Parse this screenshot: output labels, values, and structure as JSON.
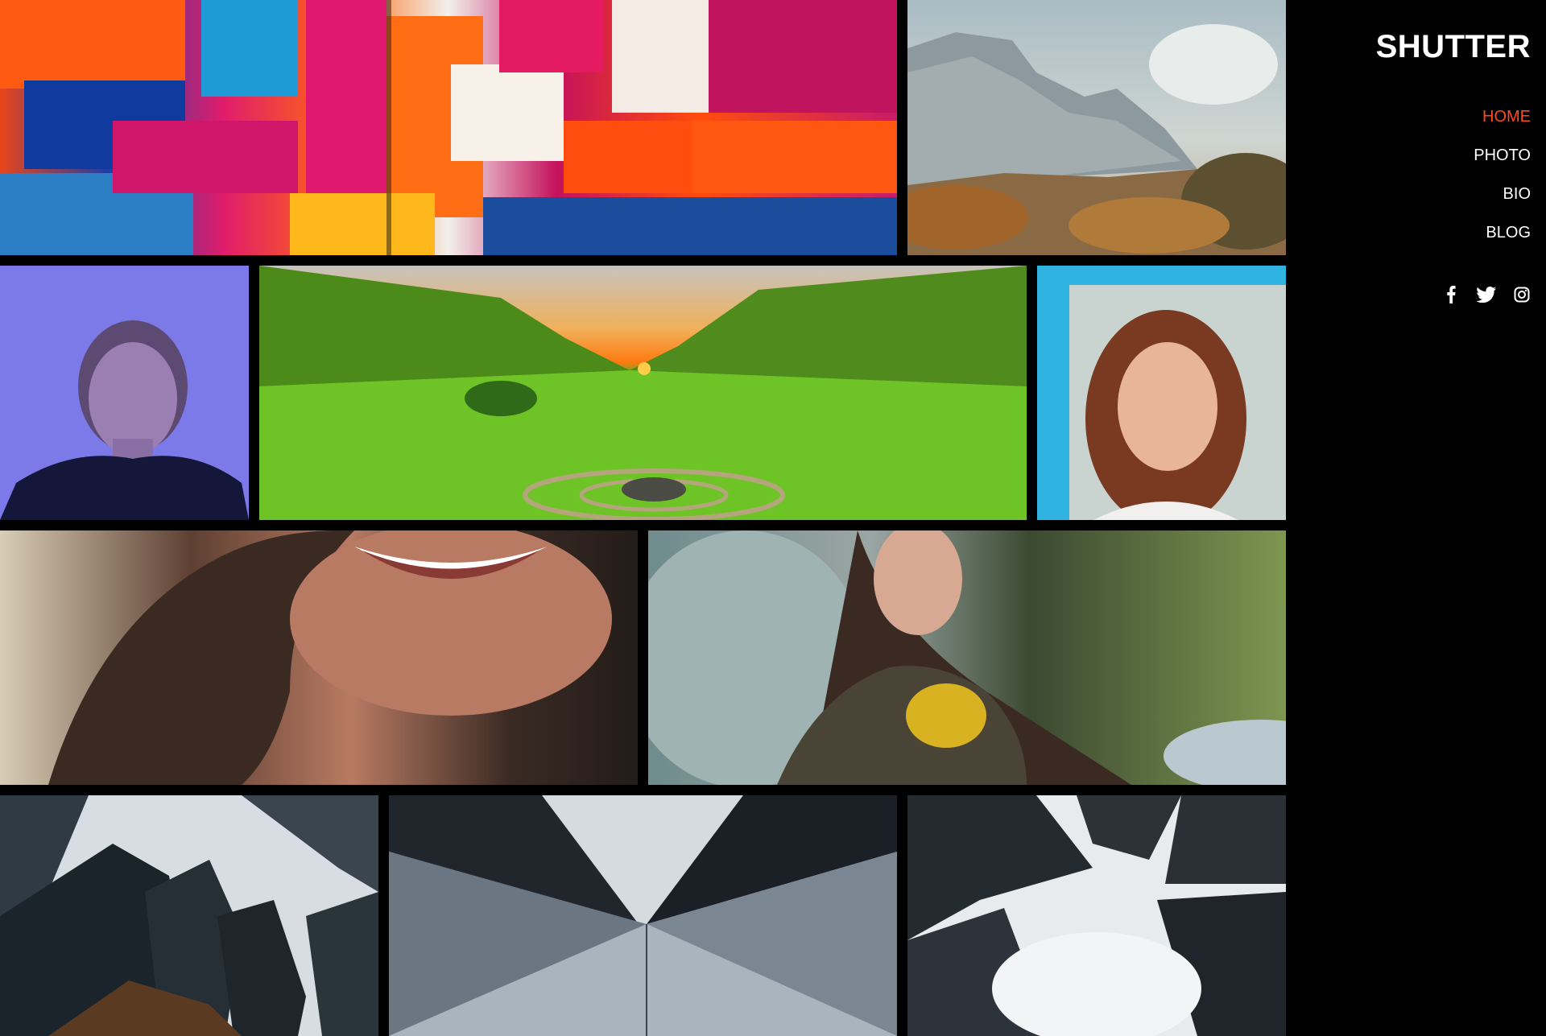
{
  "site": {
    "logo": "SHUTTER"
  },
  "nav": {
    "items": [
      {
        "label": "HOME",
        "active": true
      },
      {
        "label": "PHOTO",
        "active": false
      },
      {
        "label": "BIO",
        "active": false
      },
      {
        "label": "BLOG",
        "active": false
      }
    ],
    "active_color": "#ff4a1c"
  },
  "social": {
    "icons": [
      "facebook-icon",
      "twitter-icon",
      "instagram-icon"
    ]
  },
  "gallery": {
    "images": [
      {
        "subject": "abstract colorful painting"
      },
      {
        "subject": "mountain landscape painting"
      },
      {
        "subject": "woman portrait purple light"
      },
      {
        "subject": "green valley at sunset"
      },
      {
        "subject": "red-haired woman portrait"
      },
      {
        "subject": "smiling woman close-up"
      },
      {
        "subject": "woman with flowing hair and yellow leaves"
      },
      {
        "subject": "skyscrapers looking up"
      },
      {
        "subject": "glass building from below"
      },
      {
        "subject": "towers in fog from below"
      }
    ]
  }
}
